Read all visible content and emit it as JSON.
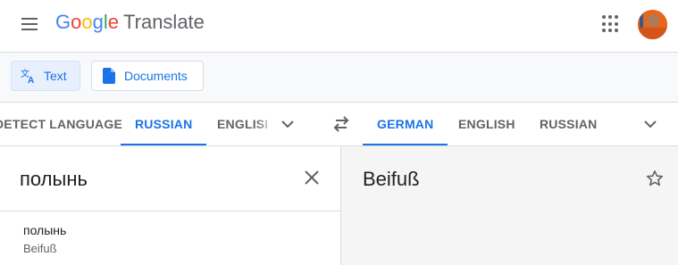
{
  "header": {
    "logo": {
      "letters": [
        "G",
        "o",
        "o",
        "g",
        "l",
        "e"
      ],
      "letter_colors": [
        "#4285F4",
        "#EA4335",
        "#FBBC05",
        "#4285F4",
        "#34A853",
        "#EA4335"
      ],
      "product": "Translate"
    },
    "icons": [
      "menu-icon",
      "apps-icon",
      "avatar"
    ]
  },
  "mode_bar": {
    "text_label": "Text",
    "documents_label": "Documents",
    "active": "text"
  },
  "source_languages": {
    "tabs": [
      {
        "label": "DETECT LANGUAGE",
        "active": false
      },
      {
        "label": "RUSSIAN",
        "active": true
      },
      {
        "label": "ENGLISH",
        "active": false
      }
    ]
  },
  "target_languages": {
    "tabs": [
      {
        "label": "GERMAN",
        "active": true
      },
      {
        "label": "ENGLISH",
        "active": false
      },
      {
        "label": "RUSSIAN",
        "active": false
      }
    ]
  },
  "source": {
    "text": "полынь"
  },
  "target": {
    "text": "Beifuß"
  },
  "dictionary": {
    "word": "полынь",
    "translation": "Beifuß"
  },
  "colors": {
    "accent": "#1a73e8",
    "muted": "#5f6368",
    "divider": "#dadce0",
    "target_bg": "#f5f5f5"
  }
}
